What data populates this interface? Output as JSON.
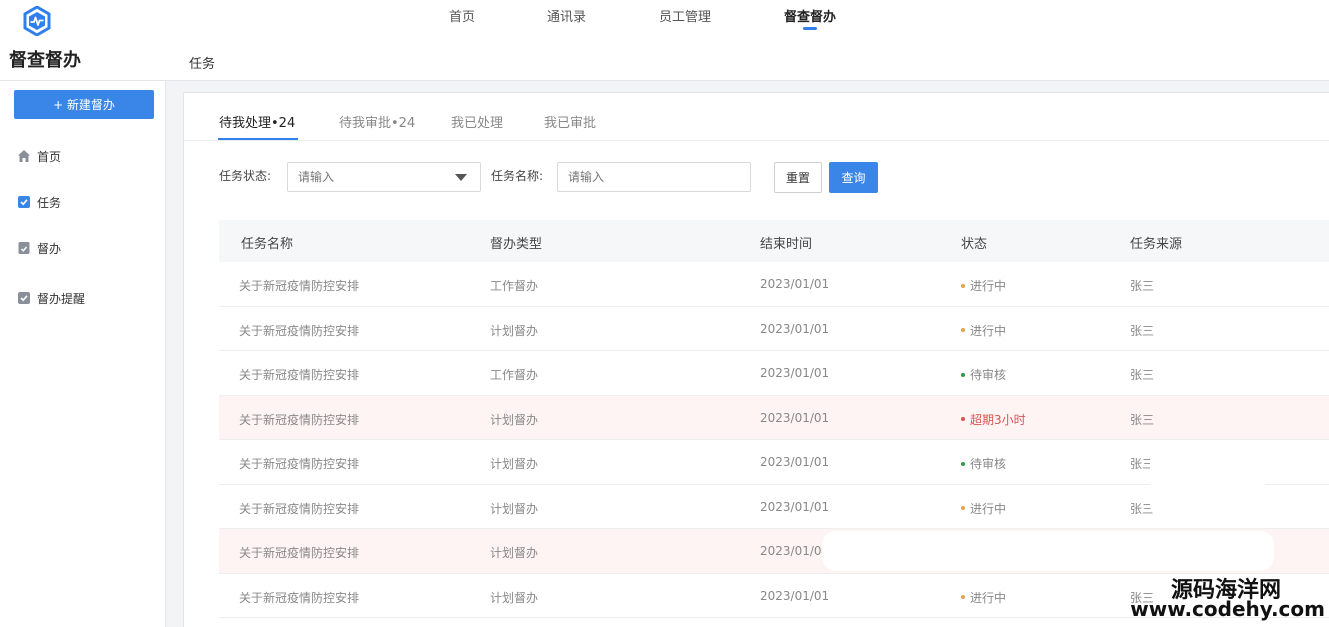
{
  "app": {
    "title": "督查督办"
  },
  "topnav": {
    "items": [
      {
        "label": "首页"
      },
      {
        "label": "通讯录"
      },
      {
        "label": "员工管理"
      },
      {
        "label": "督查督办"
      }
    ]
  },
  "breadcrumb": {
    "current": "任务"
  },
  "sidebar": {
    "new_button": "+ 新建督办",
    "items": [
      {
        "label": "首页",
        "icon": "home-icon"
      },
      {
        "label": "任务",
        "icon": "checkbox-icon"
      },
      {
        "label": "督办",
        "icon": "document-icon"
      },
      {
        "label": "督办提醒",
        "icon": "checkbox-icon"
      }
    ]
  },
  "tabs": [
    {
      "label": "待我处理•24"
    },
    {
      "label": "待我审批•24"
    },
    {
      "label": "我已处理"
    },
    {
      "label": "我已审批"
    }
  ],
  "filters": {
    "status_label": "任务状态:",
    "status_placeholder": "请输入",
    "name_label": "任务名称:",
    "name_placeholder": "请输入",
    "reset_label": "重置",
    "query_label": "查询"
  },
  "table": {
    "columns": [
      "任务名称",
      "督办类型",
      "结束时间",
      "状态",
      "任务来源"
    ],
    "rows": [
      {
        "name": "关于新冠疫情防控安排",
        "type": "工作督办",
        "end": "2023/01/01",
        "status": "进行中",
        "source": "张三"
      },
      {
        "name": "关于新冠疫情防控安排",
        "type": "计划督办",
        "end": "2023/01/01",
        "status": "进行中",
        "source": "张三"
      },
      {
        "name": "关于新冠疫情防控安排",
        "type": "工作督办",
        "end": "2023/01/01",
        "status": "待审核",
        "source": "张三"
      },
      {
        "name": "关于新冠疫情防控安排",
        "type": "计划督办",
        "end": "2023/01/01",
        "status": "超期3小时",
        "source": "张三"
      },
      {
        "name": "关于新冠疫情防控安排",
        "type": "计划督办",
        "end": "2023/01/01",
        "status": "待审核",
        "source": "张三"
      },
      {
        "name": "关于新冠疫情防控安排",
        "type": "计划督办",
        "end": "2023/01/01",
        "status": "进行中",
        "source": "张三"
      },
      {
        "name": "关于新冠疫情防控安排",
        "type": "计划督办",
        "end": "2023/01/0",
        "status": "",
        "source": ""
      },
      {
        "name": "关于新冠疫情防控安排",
        "type": "计划督办",
        "end": "2023/01/01",
        "status": "进行中",
        "source": "张三"
      }
    ]
  },
  "watermark": {
    "line1": "源码海洋网",
    "line2": "www.codehy.com"
  },
  "colors": {
    "accent": "#3a86e8",
    "overdue": "#d9534f",
    "in_progress": "#e3a34a",
    "pending_review": "#2e9a46"
  }
}
